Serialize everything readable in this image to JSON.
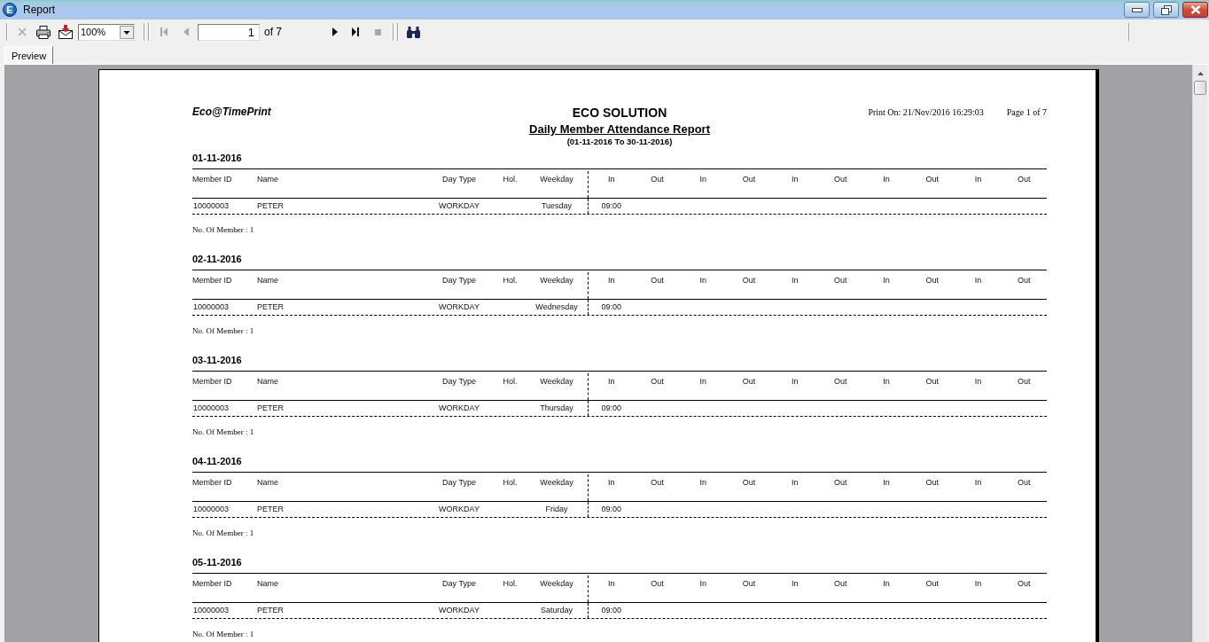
{
  "window": {
    "icon_text": "E",
    "title": "Report"
  },
  "toolbar": {
    "left_buttons": [
      {
        "kind": "close",
        "disabled": true
      },
      {
        "kind": "print",
        "disabled": false
      },
      {
        "kind": "export",
        "disabled": false
      }
    ],
    "zoom": "100%",
    "back_buttons": [
      {
        "kind": "first",
        "disabled": true
      },
      {
        "kind": "previous",
        "disabled": true
      }
    ],
    "page": "1",
    "page_total": "of 7",
    "forward_buttons": [
      {
        "kind": "next",
        "disabled": false
      },
      {
        "kind": "last",
        "disabled": false
      },
      {
        "kind": "stop",
        "disabled": true
      }
    ],
    "search_buttons": [
      {
        "kind": "find",
        "disabled": false
      }
    ]
  },
  "tabs": [
    {
      "label": "Preview",
      "selected": true
    }
  ],
  "report": {
    "brand": "Eco@TimePrint",
    "company": "ECO SOLUTION",
    "title": "Daily Member Attendance Report",
    "period": "(01-11-2016 To 30-11-2016)",
    "print_on": "Print On: 21/Nov/2016 16:29:03",
    "page": "Page 1 of 7",
    "sections": [
      {
        "date": "01-11-2016",
        "columns": [
          "Member ID",
          "Name",
          "Day Type",
          "Hol.",
          "Weekday",
          "In",
          "Out",
          "In",
          "Out",
          "In",
          "Out",
          "In",
          "Out",
          "In",
          "Out"
        ],
        "rows": [
          {
            "member_id": "10000003",
            "name": "PETER",
            "day_type": "WORKDAY",
            "weekday": "Tuesday",
            "times": [
              "09:00"
            ]
          }
        ],
        "summary": "No. Of Member : 1"
      },
      {
        "date": "02-11-2016",
        "columns": [
          "Member ID",
          "Name",
          "Day Type",
          "Hol.",
          "Weekday",
          "In",
          "Out",
          "In",
          "Out",
          "In",
          "Out",
          "In",
          "Out",
          "In",
          "Out"
        ],
        "rows": [
          {
            "member_id": "10000003",
            "name": "PETER",
            "day_type": "WORKDAY",
            "weekday": "Wednesday",
            "times": [
              "09:00"
            ]
          }
        ],
        "summary": "No. Of Member : 1"
      },
      {
        "date": "03-11-2016",
        "columns": [
          "Member ID",
          "Name",
          "Day Type",
          "Hol.",
          "Weekday",
          "In",
          "Out",
          "In",
          "Out",
          "In",
          "Out",
          "In",
          "Out",
          "In",
          "Out"
        ],
        "rows": [
          {
            "member_id": "10000003",
            "name": "PETER",
            "day_type": "WORKDAY",
            "weekday": "Thursday",
            "times": [
              "09:00"
            ]
          }
        ],
        "summary": "No. Of Member : 1"
      },
      {
        "date": "04-11-2016",
        "columns": [
          "Member ID",
          "Name",
          "Day Type",
          "Hol.",
          "Weekday",
          "In",
          "Out",
          "In",
          "Out",
          "In",
          "Out",
          "In",
          "Out",
          "In",
          "Out"
        ],
        "rows": [
          {
            "member_id": "10000003",
            "name": "PETER",
            "day_type": "WORKDAY",
            "weekday": "Friday",
            "times": [
              "09:00"
            ]
          }
        ],
        "summary": "No. Of Member : 1"
      },
      {
        "date": "05-11-2016",
        "columns": [
          "Member ID",
          "Name",
          "Day Type",
          "Hol.",
          "Weekday",
          "In",
          "Out",
          "In",
          "Out",
          "In",
          "Out",
          "In",
          "Out",
          "In",
          "Out"
        ],
        "rows": [
          {
            "member_id": "10000003",
            "name": "PETER",
            "day_type": "WORKDAY",
            "weekday": "Saturday",
            "times": [
              "09:00"
            ]
          }
        ],
        "summary": "No. Of Member : 1"
      }
    ]
  }
}
